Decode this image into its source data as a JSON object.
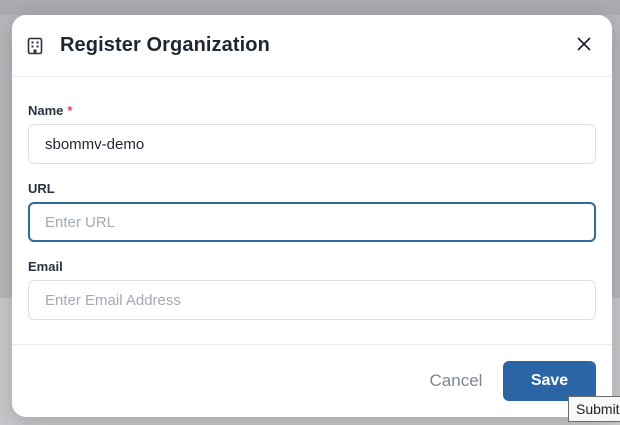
{
  "dialog": {
    "title": "Register Organization",
    "icon": "building-icon",
    "close_icon": "close-icon"
  },
  "form": {
    "name": {
      "label": "Name",
      "required_marker": "*",
      "value": "sbommv-demo"
    },
    "url": {
      "label": "URL",
      "placeholder": "Enter URL",
      "value": ""
    },
    "email": {
      "label": "Email",
      "placeholder": "Enter Email Address",
      "value": ""
    }
  },
  "footer": {
    "cancel_label": "Cancel",
    "save_label": "Save"
  },
  "tooltip": {
    "text": "Submit"
  },
  "colors": {
    "primary": "#2b65a6",
    "focus_border": "#2f6b9a",
    "required": "#e0474c"
  }
}
